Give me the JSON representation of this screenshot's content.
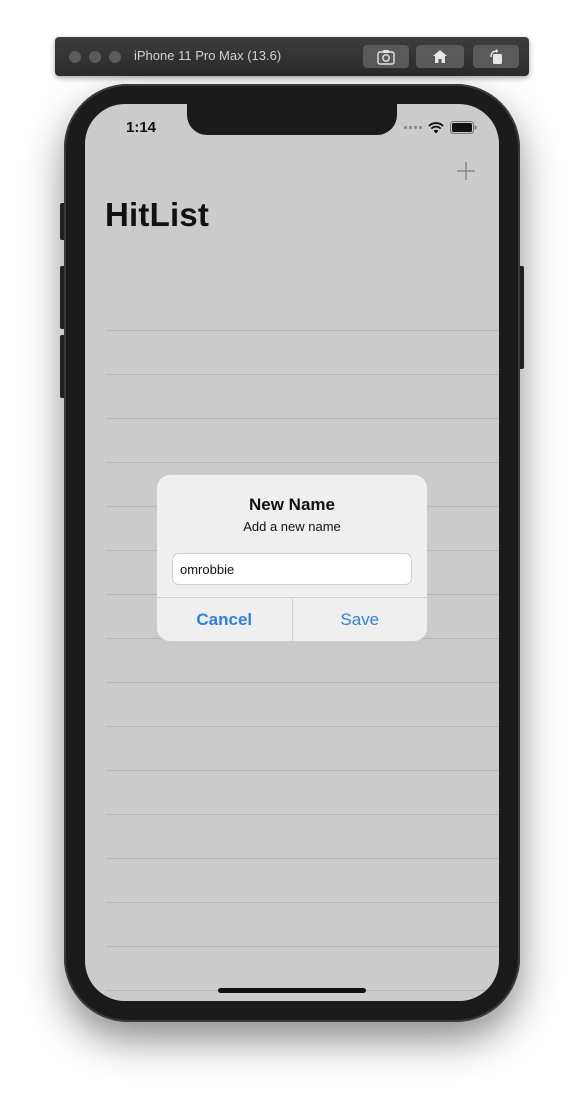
{
  "simulator": {
    "title": "iPhone 11 Pro Max (13.6)",
    "buttons": [
      "screenshot-icon",
      "home-icon",
      "rotate-icon"
    ]
  },
  "status_bar": {
    "time": "1:14",
    "icons": [
      "cellular-signal-icon",
      "wifi-icon",
      "battery-icon"
    ]
  },
  "nav": {
    "title": "HitList",
    "add_icon": "plus-icon"
  },
  "alert": {
    "title": "New Name",
    "message": "Add a new name",
    "input_value": "omrobbie",
    "cancel_label": "Cancel",
    "save_label": "Save"
  },
  "colors": {
    "accent": "#2f7fe0",
    "screen_background": "#cbcbcb",
    "alert_background": "#efefef"
  }
}
